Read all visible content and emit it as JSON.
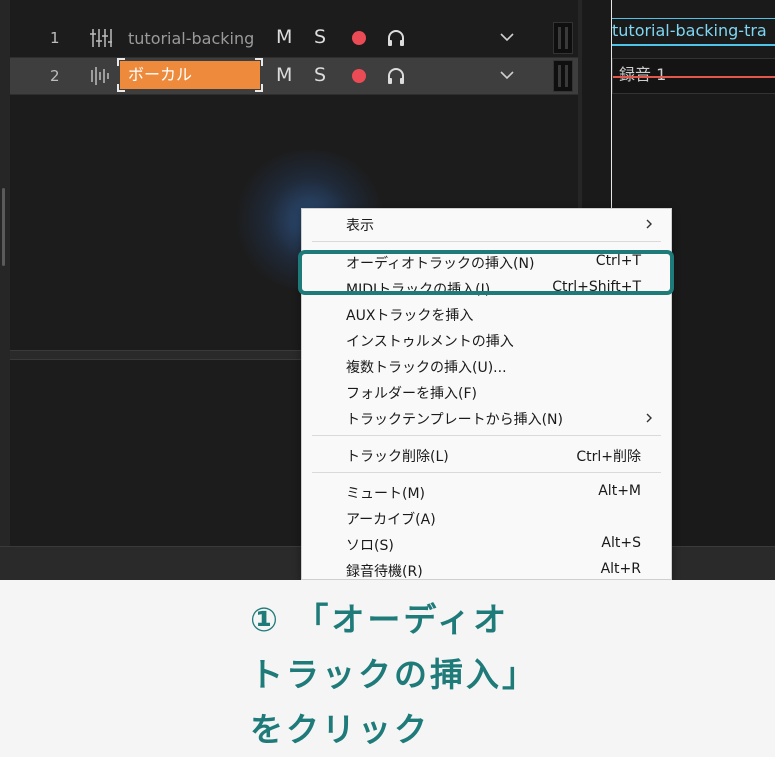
{
  "tracks": [
    {
      "number": "1",
      "name": "tutorial-backing",
      "mute_label": "M",
      "solo_label": "S"
    },
    {
      "number": "2",
      "name": "ボーカル",
      "mute_label": "M",
      "solo_label": "S"
    }
  ],
  "timeline": {
    "clips": [
      {
        "label": "tutorial-backing-tra"
      },
      {
        "label": "録音 1"
      }
    ]
  },
  "context_menu": {
    "items": [
      {
        "label": "表示",
        "shortcut": "",
        "submenu": true
      },
      {
        "label": "オーディオトラックの挿入(N)",
        "shortcut": "Ctrl+T"
      },
      {
        "label": "MIDIトラックの挿入(I)",
        "shortcut": "Ctrl+Shift+T"
      },
      {
        "label": "AUXトラックを挿入",
        "shortcut": ""
      },
      {
        "label": "インストゥルメントの挿入",
        "shortcut": ""
      },
      {
        "label": "複数トラックの挿入(U)...",
        "shortcut": ""
      },
      {
        "label": "フォルダーを挿入(F)",
        "shortcut": ""
      },
      {
        "label": "トラックテンプレートから挿入(N)",
        "shortcut": "",
        "submenu": true
      },
      {
        "label": "トラック削除(L)",
        "shortcut": "Ctrl+削除"
      },
      {
        "label": "ミュート(M)",
        "shortcut": "Alt+M"
      },
      {
        "label": "アーカイブ(A)",
        "shortcut": ""
      },
      {
        "label": "ソロ(S)",
        "shortcut": "Alt+S"
      },
      {
        "label": "録音待機(R)",
        "shortcut": "Alt+R"
      }
    ]
  },
  "annotation": {
    "lines": [
      "① 「オーディオ",
      "トラックの挿入」",
      "をクリック"
    ]
  },
  "colors": {
    "accent_teal": "#1f7b7a",
    "track_name_edit": "#ed8a3c",
    "record": "#ea4b55",
    "clip_blue": "#4fc3e8"
  },
  "icons": [
    "fader-icon",
    "record-icon",
    "headphones-icon",
    "chevron-down-icon",
    "chevron-right-icon"
  ]
}
